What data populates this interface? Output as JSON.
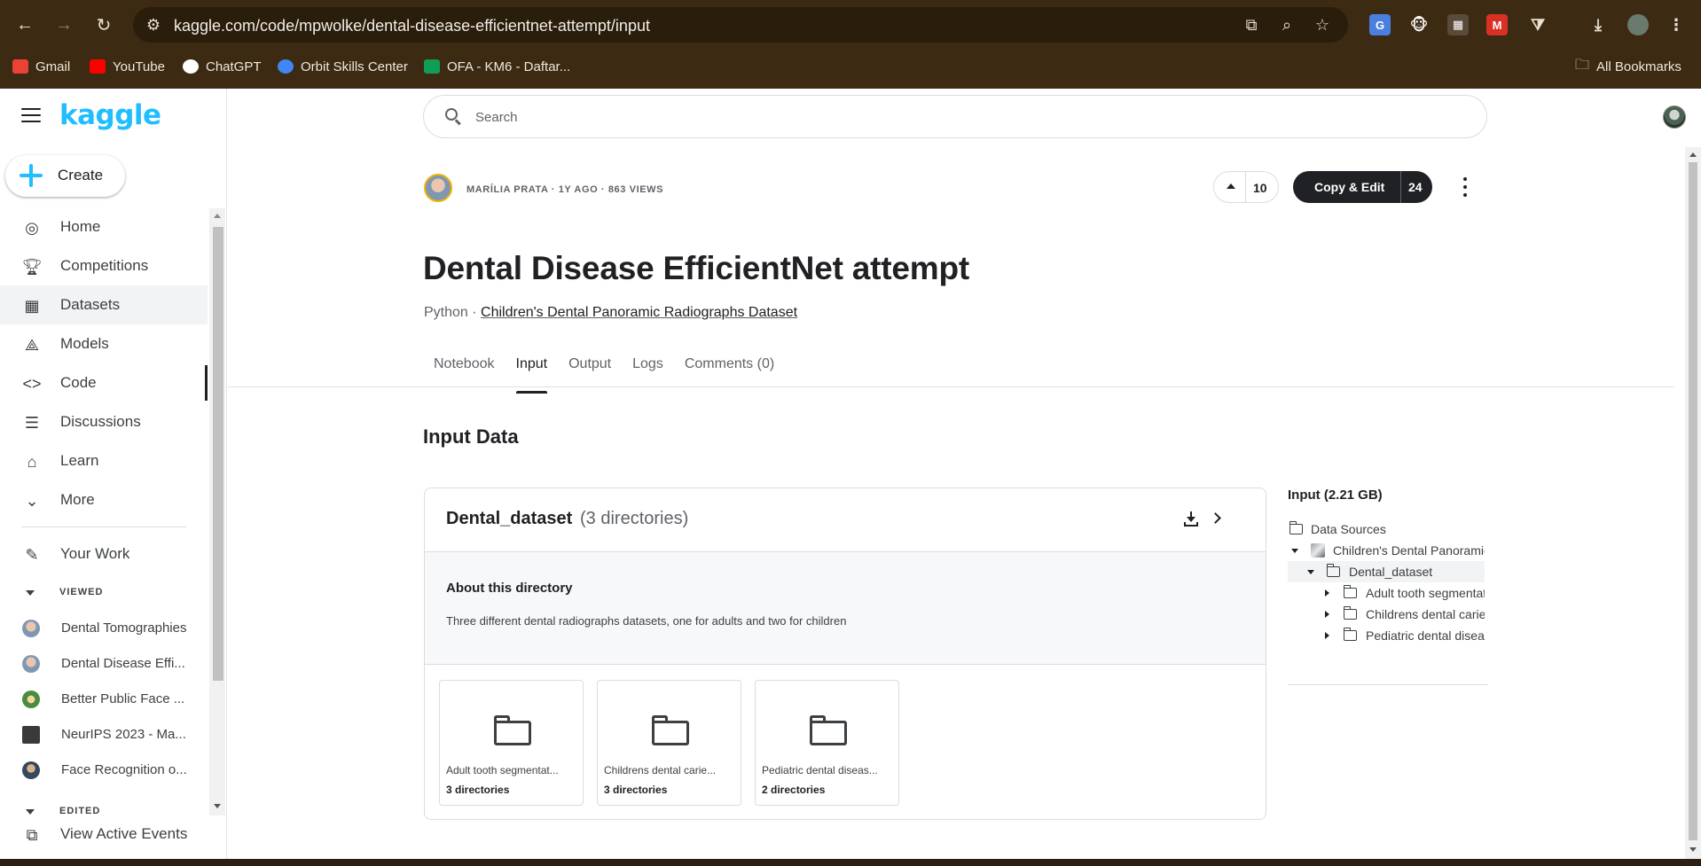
{
  "browser": {
    "url": "kaggle.com/code/mpwolke/dental-disease-efficientnet-attempt/input",
    "bookmarks": [
      {
        "label": "Gmail",
        "color": "#ea4335"
      },
      {
        "label": "YouTube",
        "color": "#ff0000"
      },
      {
        "label": "ChatGPT",
        "color": "#ffffff"
      },
      {
        "label": "Orbit Skills Center",
        "color": "#4285f4"
      },
      {
        "label": "OFA - KM6 - Daftar...",
        "color": "#0f9d58"
      }
    ],
    "all_bookmarks": "All Bookmarks",
    "chrome_color": "#3c2a12"
  },
  "sidebar": {
    "logo": "kaggle",
    "create": "Create",
    "nav": [
      {
        "label": "Home",
        "icon": "compass-icon"
      },
      {
        "label": "Competitions",
        "icon": "trophy-icon"
      },
      {
        "label": "Datasets",
        "icon": "table-icon"
      },
      {
        "label": "Models",
        "icon": "models-icon"
      },
      {
        "label": "Code",
        "icon": "code-icon"
      },
      {
        "label": "Discussions",
        "icon": "discussion-icon"
      },
      {
        "label": "Learn",
        "icon": "school-icon"
      },
      {
        "label": "More",
        "icon": "chevron-down-icon"
      }
    ],
    "your_work": "Your Work",
    "viewed_label": "VIEWED",
    "viewed": [
      "Dental Tomographies",
      "Dental Disease Effi...",
      "Better Public Face ...",
      "NeurIPS 2023 - Ma...",
      "Face Recognition o..."
    ],
    "edited_label": "EDITED",
    "view_active_events": "View Active Events"
  },
  "search": {
    "placeholder": "Search"
  },
  "notebook": {
    "author_meta": "MARÍLIA PRATA · 1Y AGO · 863 VIEWS",
    "votes": "10",
    "copy_edit": "Copy & Edit",
    "copy_count": "24",
    "title": "Dental Disease EfficientNet attempt",
    "language": "Python · ",
    "dataset_link": "Children's Dental Panoramic Radiographs Dataset",
    "tabs": [
      "Notebook",
      "Input",
      "Output",
      "Logs",
      "Comments (0)"
    ],
    "active_tab": "Input"
  },
  "input_data": {
    "heading": "Input Data",
    "card": {
      "name": "Dental_dataset",
      "count": "(3 directories)",
      "about_title": "About this directory",
      "about_text": "Three different dental radiographs datasets, one for adults and two for children",
      "tiles": [
        {
          "name": "Adult tooth segmentat...",
          "sub": "3 directories"
        },
        {
          "name": "Childrens dental carie...",
          "sub": "3 directories"
        },
        {
          "name": "Pediatric dental diseas...",
          "sub": "2 directories"
        }
      ]
    },
    "tree": {
      "title": "Input (2.21 GB)",
      "data_sources": "Data Sources",
      "dataset": "Children's Dental Panoramic Radiographs Dataset",
      "folder": "Dental_dataset",
      "children": [
        "Adult tooth segmentation dataset",
        "Childrens dental caries segmentation dataset",
        "Pediatric dental disease detection dataset"
      ]
    }
  }
}
